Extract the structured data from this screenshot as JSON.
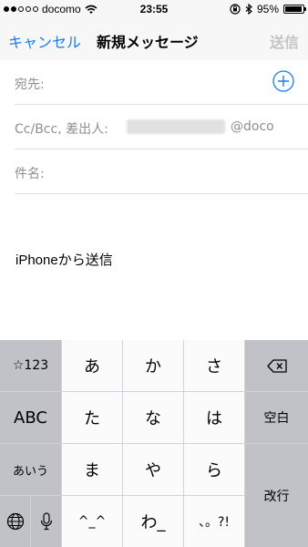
{
  "status_bar": {
    "carrier": "docomo",
    "time": "23:55",
    "battery": "95%",
    "battery_level": 0.95,
    "signal_filled": 2,
    "signal_total": 5,
    "icons": [
      "wifi-icon",
      "rotation-lock-icon",
      "bluetooth-icon",
      "battery-icon"
    ]
  },
  "nav": {
    "cancel": "キャンセル",
    "title": "新規メッセージ",
    "send": "送信"
  },
  "compose": {
    "to_label": "宛先:",
    "cc_label": "Cc/Bcc, 差出人:",
    "cc_domain": "@doco",
    "subject_label": "件名:",
    "signature": "iPhoneから送信"
  },
  "keyboard": {
    "mode_123": "☆123",
    "abc": "ABC",
    "kana": "あいう",
    "a": "あ",
    "ka": "か",
    "sa": "さ",
    "ta": "た",
    "na": "な",
    "ha": "は",
    "ma": "ま",
    "ya": "や",
    "ra": "ら",
    "caret": "^_^",
    "wa": "わ_",
    "punct": "、。?!",
    "space": "空白",
    "return": "改行"
  },
  "colors": {
    "accent": "#1a7bf0",
    "disabled": "#c4c4c8",
    "placeholder": "#8e8e93"
  }
}
